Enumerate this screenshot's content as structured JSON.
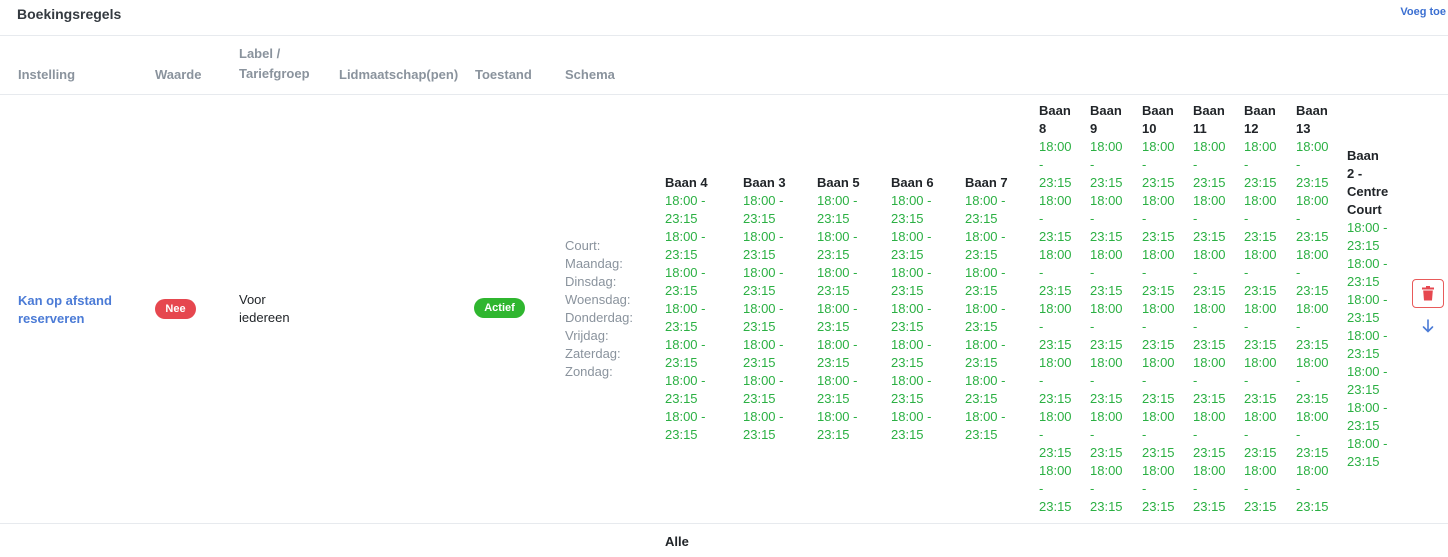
{
  "header": {
    "title": "Boekingsregels",
    "add_label": "Voeg toe"
  },
  "columns": [
    "Instelling",
    "Waarde",
    "Label /\nTariefgroep",
    "Lidmaatschap(pen)",
    "Toestand",
    "Schema"
  ],
  "row": {
    "setting": "Kan op afstand reserveren",
    "value_badge": "Nee",
    "label": "Voor iedereen",
    "membership": "",
    "status_badge": "Actief",
    "schedule_labels": [
      "Court:",
      "Maandag:",
      "Dinsdag:",
      "Woensdag:",
      "Donderdag:",
      "Vrijdag:",
      "Zaterdag:",
      "Zondag:"
    ],
    "courts": [
      {
        "name": "Baan 4",
        "slots": [
          "18:00 - 23:15",
          "18:00 - 23:15",
          "18:00 - 23:15",
          "18:00 - 23:15",
          "18:00 - 23:15",
          "18:00 - 23:15",
          "18:00 - 23:15"
        ]
      },
      {
        "name": "Baan 3",
        "slots": [
          "18:00 - 23:15",
          "18:00 - 23:15",
          "18:00 - 23:15",
          "18:00 - 23:15",
          "18:00 - 23:15",
          "18:00 - 23:15",
          "18:00 - 23:15"
        ]
      },
      {
        "name": "Baan 5",
        "slots": [
          "18:00 - 23:15",
          "18:00 - 23:15",
          "18:00 - 23:15",
          "18:00 - 23:15",
          "18:00 - 23:15",
          "18:00 - 23:15",
          "18:00 - 23:15"
        ]
      },
      {
        "name": "Baan 6",
        "slots": [
          "18:00 - 23:15",
          "18:00 - 23:15",
          "18:00 - 23:15",
          "18:00 - 23:15",
          "18:00 - 23:15",
          "18:00 - 23:15",
          "18:00 - 23:15"
        ]
      },
      {
        "name": "Baan 7",
        "slots": [
          "18:00 - 23:15",
          "18:00 - 23:15",
          "18:00 - 23:15",
          "18:00 - 23:15",
          "18:00 - 23:15",
          "18:00 - 23:15",
          "18:00 - 23:15"
        ]
      },
      {
        "name": "Baan 8",
        "slots": [
          "18:00 - 23:15",
          "18:00 - 23:15",
          "18:00 - 23:15",
          "18:00 - 23:15",
          "18:00 - 23:15",
          "18:00 - 23:15",
          "18:00 - 23:15"
        ]
      },
      {
        "name": "Baan 9",
        "slots": [
          "18:00 - 23:15",
          "18:00 - 23:15",
          "18:00 - 23:15",
          "18:00 - 23:15",
          "18:00 - 23:15",
          "18:00 - 23:15",
          "18:00 - 23:15"
        ]
      },
      {
        "name": "Baan 10",
        "slots": [
          "18:00 - 23:15",
          "18:00 - 23:15",
          "18:00 - 23:15",
          "18:00 - 23:15",
          "18:00 - 23:15",
          "18:00 - 23:15",
          "18:00 - 23:15"
        ]
      },
      {
        "name": "Baan 11",
        "slots": [
          "18:00 - 23:15",
          "18:00 - 23:15",
          "18:00 - 23:15",
          "18:00 - 23:15",
          "18:00 - 23:15",
          "18:00 - 23:15",
          "18:00 - 23:15"
        ]
      },
      {
        "name": "Baan 12",
        "slots": [
          "18:00 - 23:15",
          "18:00 - 23:15",
          "18:00 - 23:15",
          "18:00 - 23:15",
          "18:00 - 23:15",
          "18:00 - 23:15",
          "18:00 - 23:15"
        ]
      },
      {
        "name": "Baan 13",
        "slots": [
          "18:00 - 23:15",
          "18:00 - 23:15",
          "18:00 - 23:15",
          "18:00 - 23:15",
          "18:00 - 23:15",
          "18:00 - 23:15",
          "18:00 - 23:15"
        ]
      },
      {
        "name": "Baan 2 - Centre Court",
        "slots": [
          "18:00 - 23:15",
          "18:00 - 23:15",
          "18:00 - 23:15",
          "18:00 - 23:15",
          "18:00 - 23:15",
          "18:00 - 23:15",
          "18:00 - 23:15"
        ]
      }
    ],
    "actions": {
      "delete_icon": "trash-icon",
      "move_down_icon": "arrow-down-icon"
    }
  },
  "next_row": {
    "court_partial": "Alle"
  },
  "colors": {
    "link": "#4b7bd6",
    "danger": "#e6474f",
    "success": "#2fb62f",
    "slot_text": "#2bb043",
    "muted": "#8a939d"
  }
}
